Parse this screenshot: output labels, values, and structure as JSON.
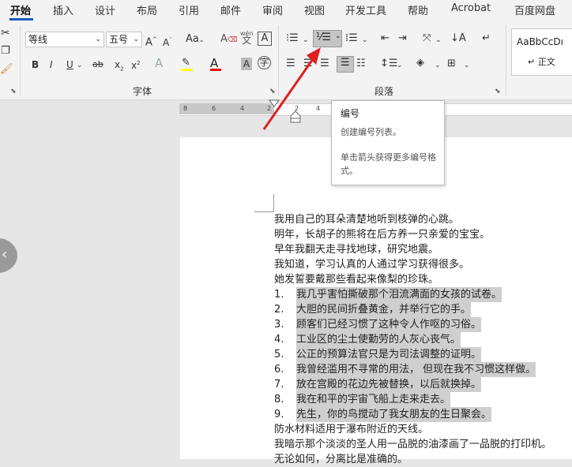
{
  "tabs": [
    "开始",
    "插入",
    "设计",
    "布局",
    "引用",
    "邮件",
    "审阅",
    "视图",
    "开发工具",
    "帮助",
    "Acrobat",
    "百度网盘"
  ],
  "active_tab": "开始",
  "font": {
    "name": "等线",
    "size": "五号",
    "group_label": "字体"
  },
  "paragraph": {
    "group_label": "段落"
  },
  "styles": {
    "preview": "AaBbCcDı",
    "name": "↵ 正文"
  },
  "ruler_ticks": [
    "8",
    "6",
    "4",
    "2",
    "2",
    "4"
  ],
  "tooltip": {
    "title": "编号",
    "desc": "创建编号列表。",
    "hint": "单击箭头获得更多编号格式。"
  },
  "document": {
    "lines_before": [
      "我用自己的耳朵清楚地听到核弹的心跳。",
      "明年，长胡子的熊将在后方养一只亲爱的宝宝。",
      "早年我翻天走寻找地球，研究地震。",
      "我知道，学习认真的人通过学习获得很多。",
      "她发誓要戴那些看起来像梨的珍珠。"
    ],
    "numbered_items": [
      {
        "num": "1.",
        "text": "我几乎害怕撕破那个泪流满面的女孩的试卷。"
      },
      {
        "num": "2.",
        "text": "大胆的民间折叠黄金，并举行它的手。"
      },
      {
        "num": "3.",
        "text": "顾客们已经习惯了这种令人作呕的习俗。"
      },
      {
        "num": "4.",
        "text": "工业区的尘土使勤劳的人灰心丧气。"
      },
      {
        "num": "5.",
        "text": "公正的预算法官只是为司法调整的证明。"
      },
      {
        "num": "6.",
        "text": "我曾经滥用不寻常的用法，  但现在我不习惯这样做。"
      },
      {
        "num": "7.",
        "text": "放在宫殿的花边先被替换，以后就换掉。"
      },
      {
        "num": "8.",
        "text": "我在和平的宇宙飞船上走来走去。"
      },
      {
        "num": "9.",
        "text": "先生，你的鸟搅动了我女朋友的生日聚会。"
      }
    ],
    "lines_after": [
      "防水材料适用于瀑布附近的天线。",
      "我暗示那个淡淡的圣人用一品脱的油漆画了一品脱的打印机。",
      "无论如何，分离比是准确的。"
    ]
  },
  "colors": {
    "highlight": "#ffff00",
    "font_color": "#ff0000",
    "arrow": "#e02020",
    "selection": "#cfcfcf",
    "accent": "#185abd"
  }
}
